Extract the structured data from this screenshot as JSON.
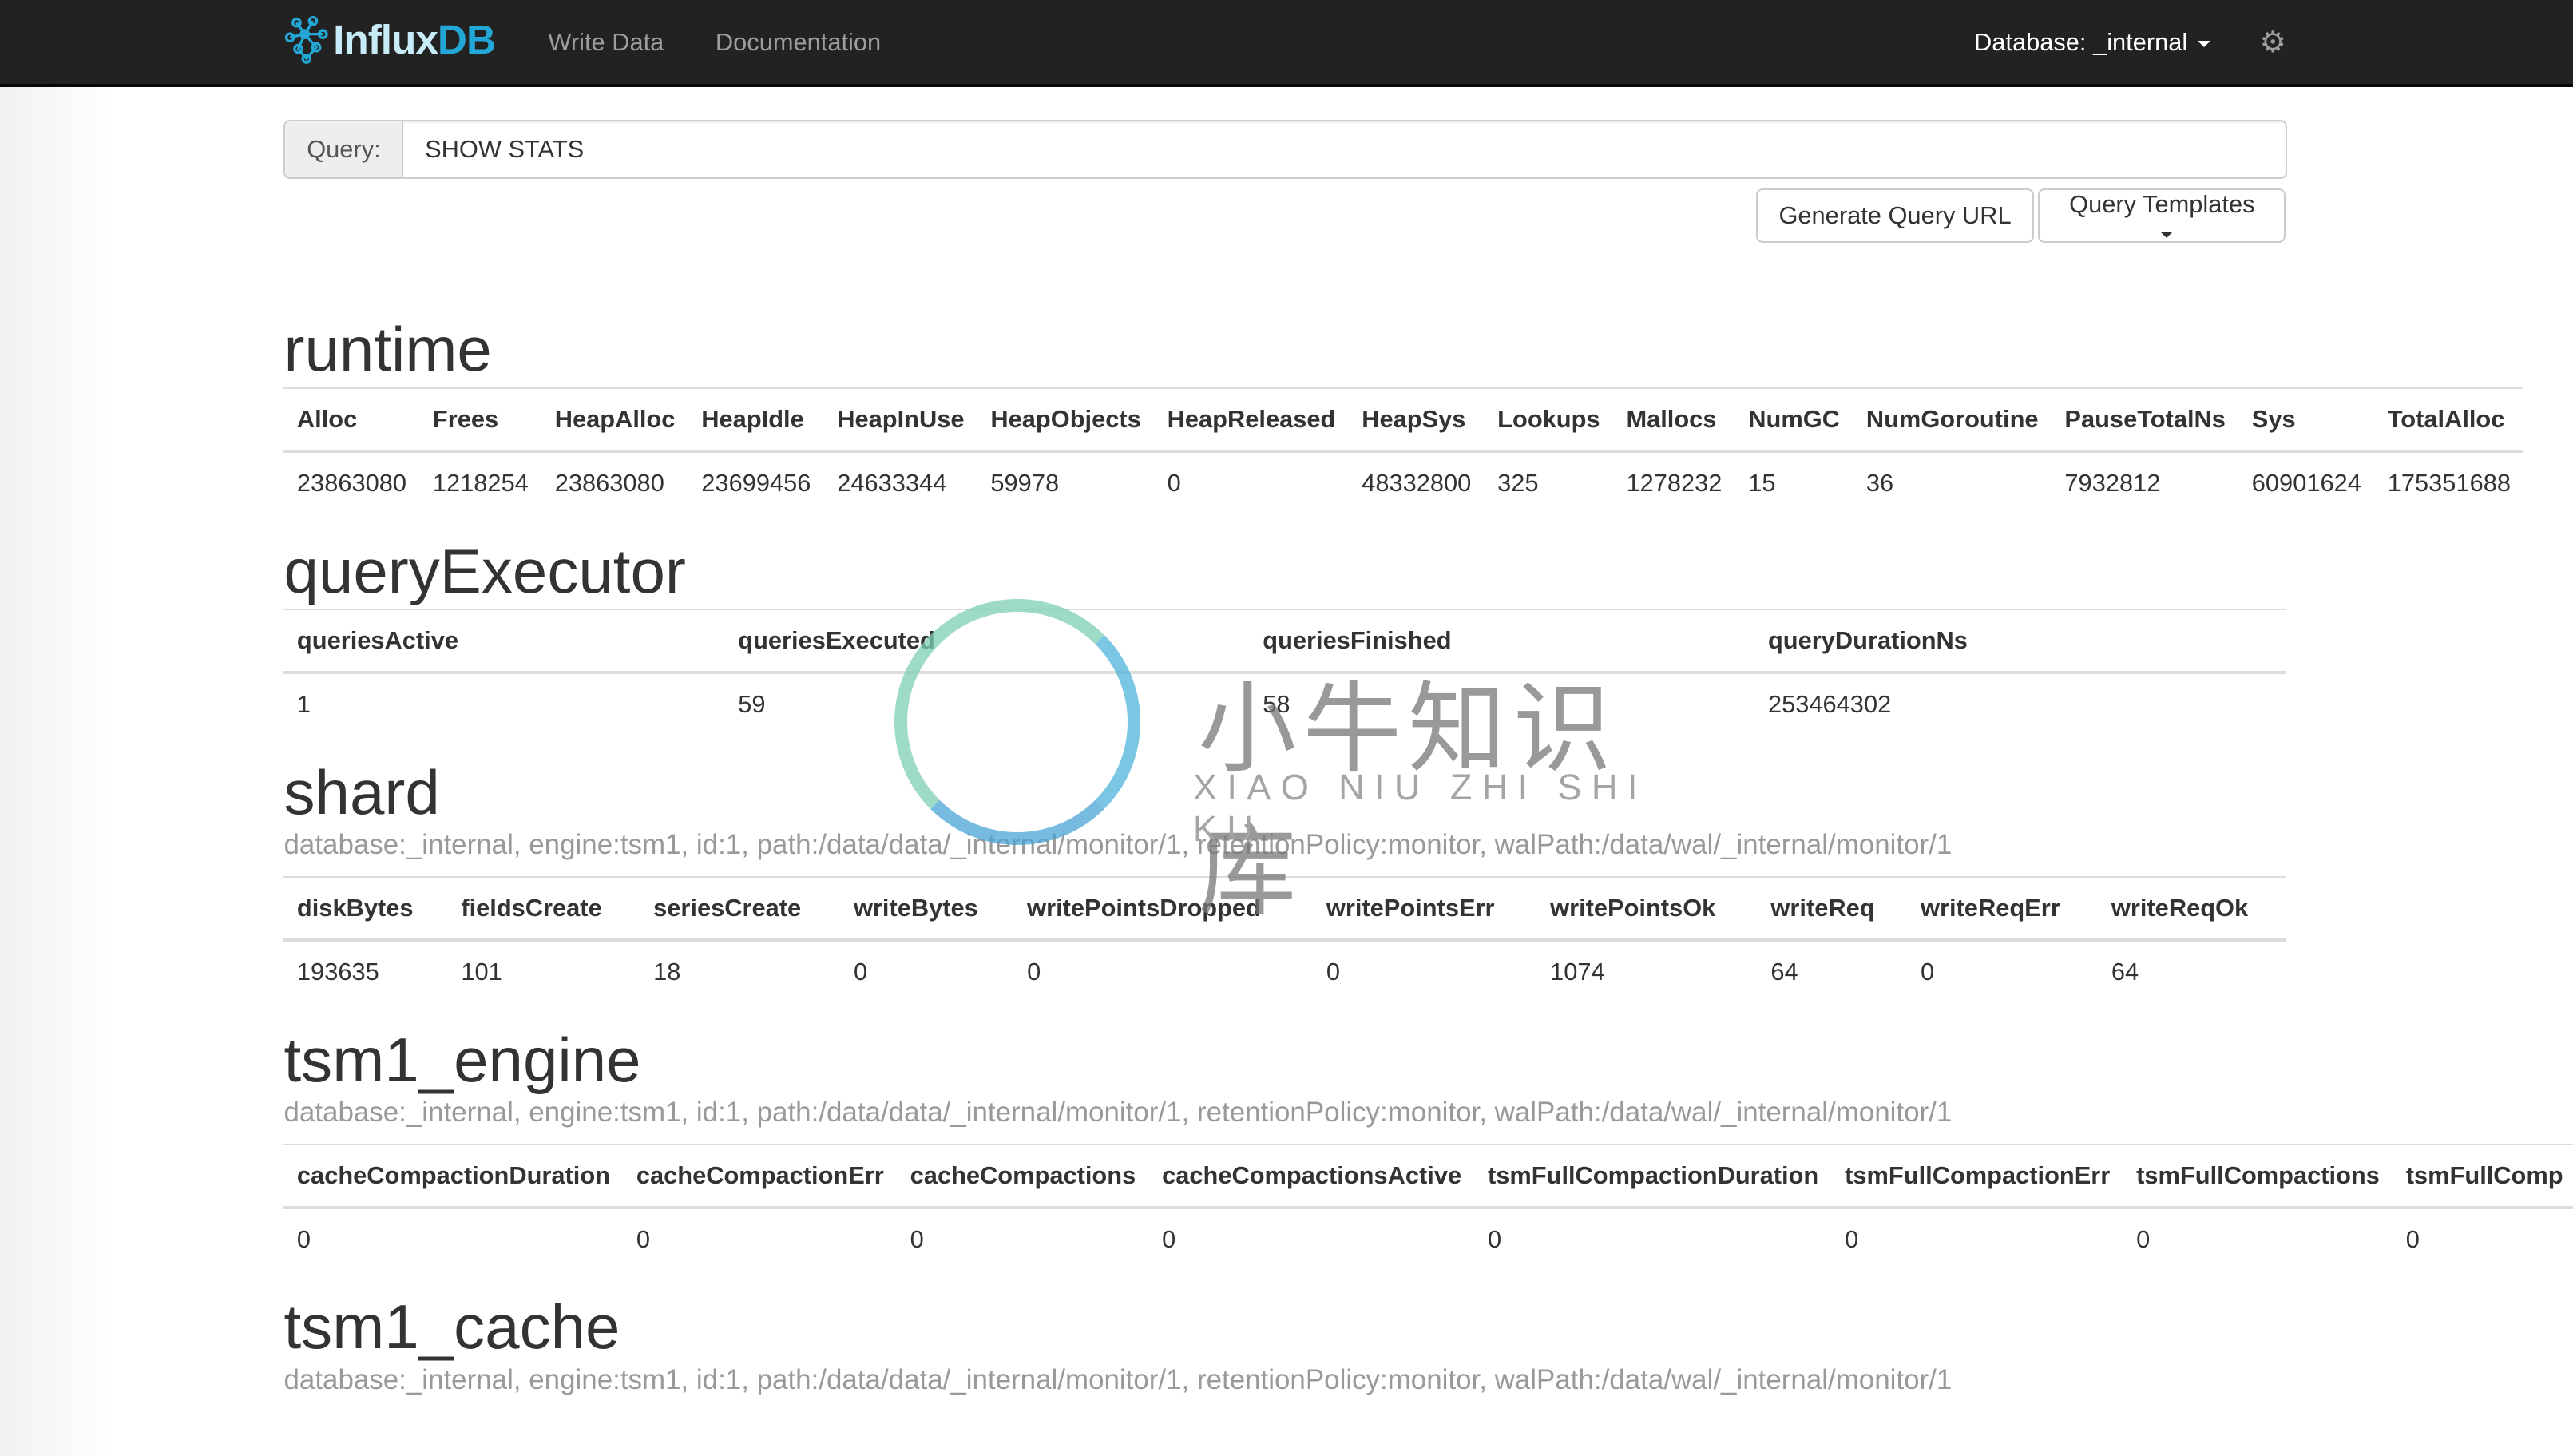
{
  "nav": {
    "logo": "InfluxDB",
    "logo_a": "Influx",
    "logo_b": "DB",
    "links": [
      "Write Data",
      "Documentation"
    ],
    "database": "Database: _internal",
    "settings_icon": "gear-icon"
  },
  "query": {
    "label": "Query:",
    "value": "SHOW STATS"
  },
  "buttons": {
    "generate": "Generate Query URL",
    "templates": "Query Templates"
  },
  "colors": {
    "navbar": "#222222",
    "brand_light": "#c8ecf7",
    "brand": "#22a7d6"
  },
  "watermark": {
    "cn": "小牛知识库",
    "py": "XIAO NIU ZHI SHI KU"
  },
  "sections": [
    {
      "name": "runtime",
      "tags": "",
      "full": false,
      "columns": [
        "Alloc",
        "Frees",
        "HeapAlloc",
        "HeapIdle",
        "HeapInUse",
        "HeapObjects",
        "HeapReleased",
        "HeapSys",
        "Lookups",
        "Mallocs",
        "NumGC",
        "NumGoroutine",
        "PauseTotalNs",
        "Sys",
        "TotalAlloc"
      ],
      "rows": [
        [
          "23863080",
          "1218254",
          "23863080",
          "23699456",
          "24633344",
          "59978",
          "0",
          "48332800",
          "325",
          "1278232",
          "15",
          "36",
          "7932812",
          "60901624",
          "175351688"
        ]
      ]
    },
    {
      "name": "queryExecutor",
      "tags": "",
      "full": true,
      "columns": [
        "queriesActive",
        "queriesExecuted",
        "queriesFinished",
        "queryDurationNs"
      ],
      "rows": [
        [
          "1",
          "59",
          "58",
          "253464302"
        ]
      ]
    },
    {
      "name": "shard",
      "tags": "database:_internal, engine:tsm1, id:1, path:/data/data/_internal/monitor/1, retentionPolicy:monitor, walPath:/data/wal/_internal/monitor/1",
      "full": true,
      "columns": [
        "diskBytes",
        "fieldsCreate",
        "seriesCreate",
        "writeBytes",
        "writePointsDropped",
        "writePointsErr",
        "writePointsOk",
        "writeReq",
        "writeReqErr",
        "writeReqOk"
      ],
      "rows": [
        [
          "193635",
          "101",
          "18",
          "0",
          "0",
          "0",
          "1074",
          "64",
          "0",
          "64"
        ]
      ]
    },
    {
      "name": "tsm1_engine",
      "tags": "database:_internal, engine:tsm1, id:1, path:/data/data/_internal/monitor/1, retentionPolicy:monitor, walPath:/data/wal/_internal/monitor/1",
      "full": false,
      "columns": [
        "cacheCompactionDuration",
        "cacheCompactionErr",
        "cacheCompactions",
        "cacheCompactionsActive",
        "tsmFullCompactionDuration",
        "tsmFullCompactionErr",
        "tsmFullCompactions",
        "tsmFullComp"
      ],
      "rows": [
        [
          "0",
          "0",
          "0",
          "0",
          "0",
          "0",
          "0",
          "0"
        ]
      ]
    },
    {
      "name": "tsm1_cache",
      "tags": "database:_internal, engine:tsm1, id:1, path:/data/data/_internal/monitor/1, retentionPolicy:monitor, walPath:/data/wal/_internal/monitor/1",
      "full": false,
      "columns": [],
      "rows": []
    }
  ]
}
